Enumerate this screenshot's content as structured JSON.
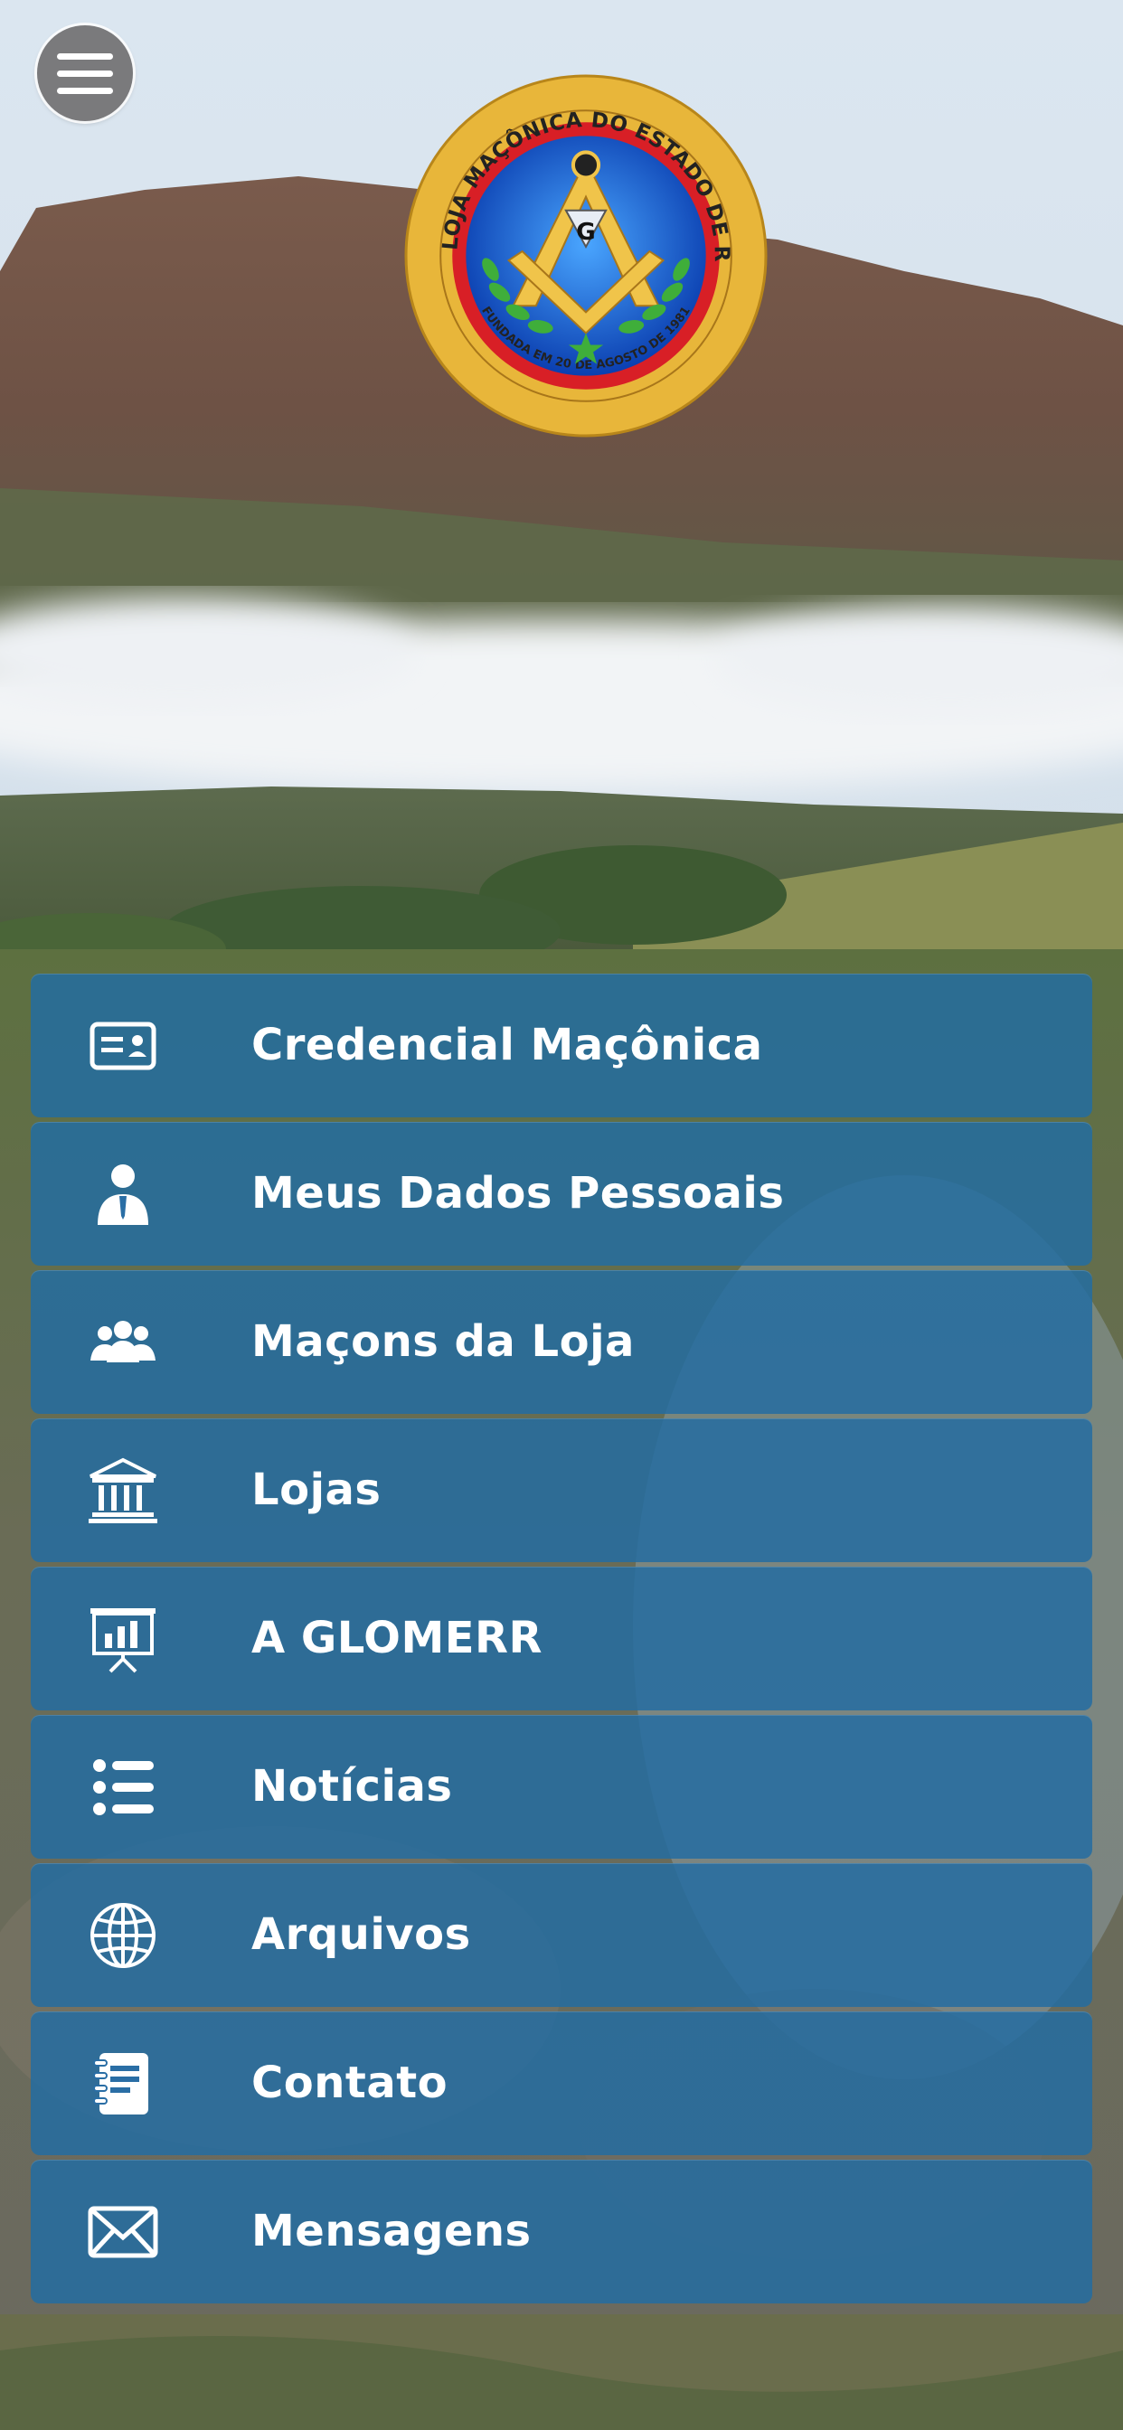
{
  "logo": {
    "ring_text": "GRANDE LOJA MAÇÔNICA DO ESTADO DE RORAIMA",
    "founded_text": "FUNDADA EM 20 DE AGOSTO DE 1981",
    "center_letter": "G"
  },
  "menu": {
    "items": [
      {
        "label": "Credencial Maçônica",
        "icon": "id-card-icon"
      },
      {
        "label": "Meus Dados Pessoais",
        "icon": "person-icon"
      },
      {
        "label": "Maçons da Loja",
        "icon": "group-icon"
      },
      {
        "label": "Lojas",
        "icon": "temple-icon"
      },
      {
        "label": "A GLOMERR",
        "icon": "presentation-icon"
      },
      {
        "label": "Notícias",
        "icon": "list-icon"
      },
      {
        "label": "Arquivos",
        "icon": "globe-icon"
      },
      {
        "label": "Contato",
        "icon": "notebook-icon"
      },
      {
        "label": "Mensagens",
        "icon": "envelope-icon"
      }
    ]
  },
  "colors": {
    "menu_item_bg": "#226ca2",
    "menu_button_bg": "#7a7a7c",
    "logo_ring_red": "#d81f26",
    "logo_gold": "#e8b63a",
    "logo_blue": "#1565d8"
  }
}
